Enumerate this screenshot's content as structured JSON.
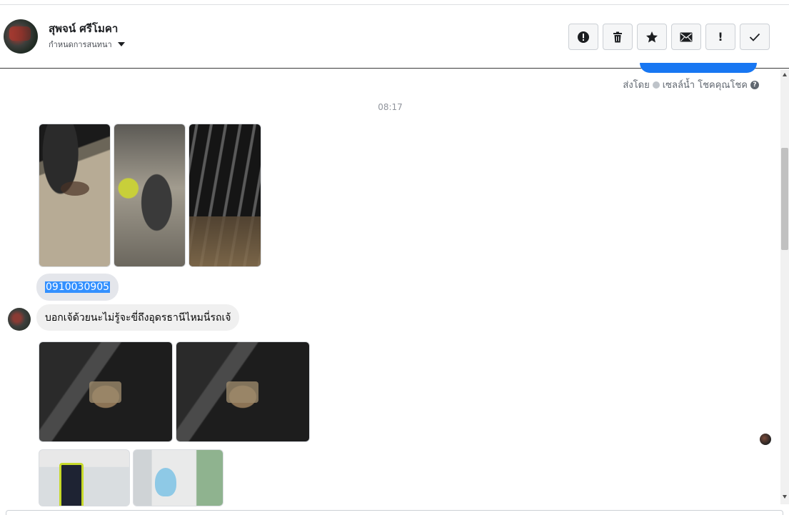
{
  "header": {
    "contact_name": "สุพจน์ ศรีโมคา",
    "subtitle": "กำหนดการสนทนา",
    "toolbar": [
      {
        "name": "report-button",
        "icon": "exclamation-circle-icon"
      },
      {
        "name": "delete-button",
        "icon": "trash-icon"
      },
      {
        "name": "star-button",
        "icon": "star-icon"
      },
      {
        "name": "mark-unread-button",
        "icon": "envelope-icon"
      },
      {
        "name": "important-button",
        "icon": "exclamation-icon",
        "label": "!"
      },
      {
        "name": "done-button",
        "icon": "check-icon"
      }
    ]
  },
  "conversation": {
    "sent_by_prefix": "ส่งโดย",
    "sent_by_name": "เซลล์น้ำ โชคคุณโชค",
    "help_icon_text": "?",
    "timestamp": "08:17",
    "phone_message": "0910030905",
    "text_message": "บอกเจ้ด้วยนะไม่รู้จะขี่ถึงอุดรธานีไหมนี่รถเจ้"
  },
  "colors": {
    "accent": "#1877f2",
    "selection": "#3390ff",
    "bubble": "#f0f0f0"
  }
}
